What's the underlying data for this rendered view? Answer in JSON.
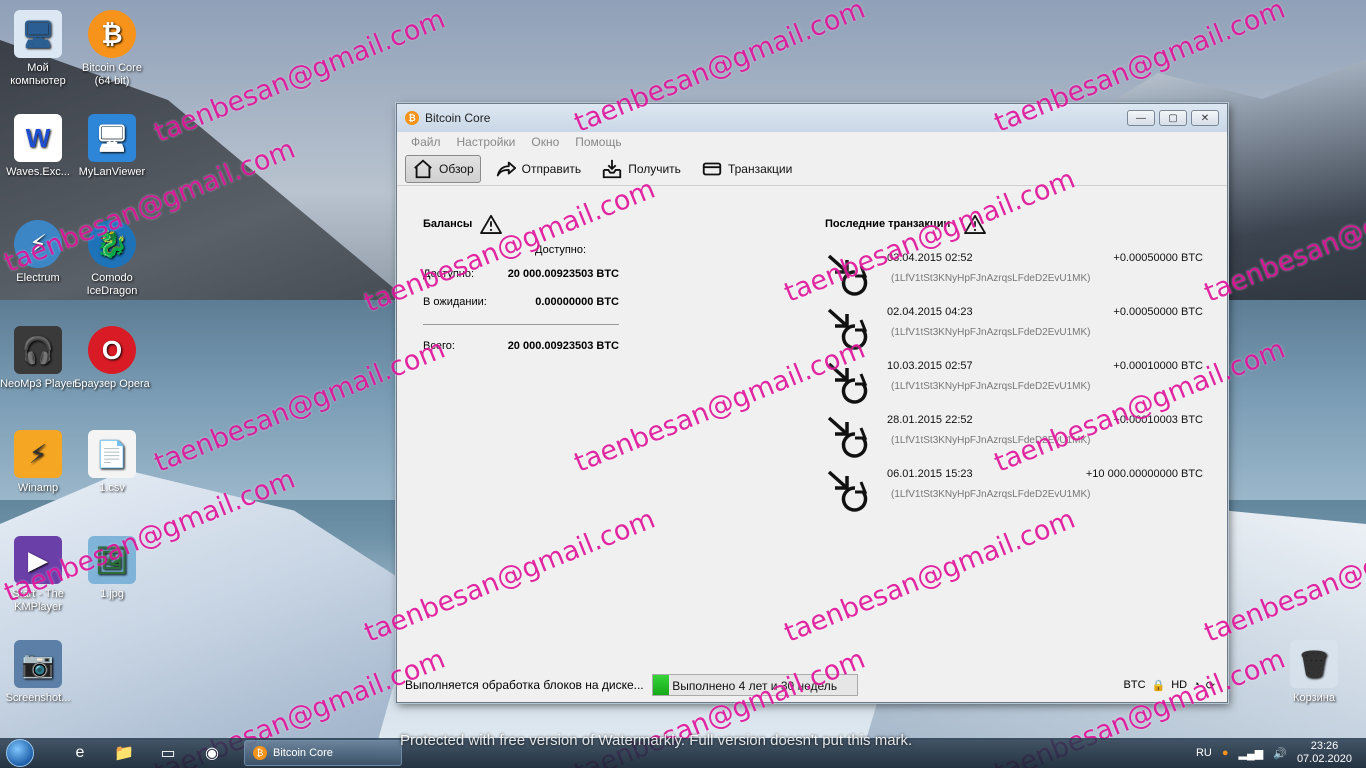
{
  "desktop": {
    "icons": [
      {
        "label": "Мой компьютер",
        "glyph": "🖥"
      },
      {
        "label": "Bitcoin Core (64-bit)",
        "glyph": "₿"
      },
      {
        "label": "Waves.Exc...",
        "glyph": "W"
      },
      {
        "label": "MyLanViewer",
        "glyph": "🖥"
      },
      {
        "label": "Electrum",
        "glyph": "⚡"
      },
      {
        "label": "Comodo IceDragon",
        "glyph": "🐉"
      },
      {
        "label": "NeoMp3 Player",
        "glyph": "🎧"
      },
      {
        "label": "Браузер Opera",
        "glyph": "O"
      },
      {
        "label": "Winamp",
        "glyph": "⚡"
      },
      {
        "label": "1.csv",
        "glyph": "📄"
      },
      {
        "label": "Start - The KMPlayer",
        "glyph": "▶"
      },
      {
        "label": "1.jpg",
        "glyph": "🖼"
      },
      {
        "label": "Screenshot...",
        "glyph": "📷"
      },
      {
        "label": "Корзина",
        "glyph": "🗑"
      }
    ],
    "watermark": "taenbesan@gmail.com",
    "watermarkly_notice": "Protected with free version of Watermarkly. Full version doesn't put this mark."
  },
  "window": {
    "title": "Bitcoin Core",
    "menu": [
      "Файл",
      "Настройки",
      "Окно",
      "Помощь"
    ],
    "toolbar": {
      "overview": "Обзор",
      "send": "Отправить",
      "receive": "Получить",
      "transactions": "Транзакции"
    },
    "balances": {
      "heading": "Балансы",
      "column_header": "Доступно:",
      "available_label": "Доступно:",
      "available_value": "20 000.00923503 BTC",
      "pending_label": "В ожидании:",
      "pending_value": "0.00000000 BTC",
      "total_label": "Всего:",
      "total_value": "20 000.00923503 BTC"
    },
    "recent": {
      "heading": "Последние транзакции",
      "items": [
        {
          "date": "03.04.2015 02:52",
          "amount": "+0.00050000 BTC",
          "address": "(1LfV1tSt3KNyHpFJnAzrqsLFdeD2EvU1MK)"
        },
        {
          "date": "02.04.2015 04:23",
          "amount": "+0.00050000 BTC",
          "address": "(1LfV1tSt3KNyHpFJnAzrqsLFdeD2EvU1MK)"
        },
        {
          "date": "10.03.2015 02:57",
          "amount": "+0.00010000 BTC",
          "address": "(1LfV1tSt3KNyHpFJnAzrqsLFdeD2EvU1MK)"
        },
        {
          "date": "28.01.2015 22:52",
          "amount": "+0.00010003 BTC",
          "address": "(1LfV1tSt3KNyHpFJnAzrqsLFdeD2EvU1MK)"
        },
        {
          "date": "06.01.2015 15:23",
          "amount": "+10 000.00000000 BTC",
          "address": "(1LfV1tSt3KNyHpFJnAzrqsLFdeD2EvU1MK)"
        }
      ]
    },
    "status": {
      "message": "Выполняется обработка блоков на диске...",
      "progress_text": "Выполнено 4 лет и 30 недель",
      "progress_fraction": 0.08,
      "unit": "BTC"
    }
  },
  "taskbar": {
    "task_label": "Bitcoin Core",
    "lang": "RU",
    "time": "23:26",
    "date": "07.02.2020"
  }
}
